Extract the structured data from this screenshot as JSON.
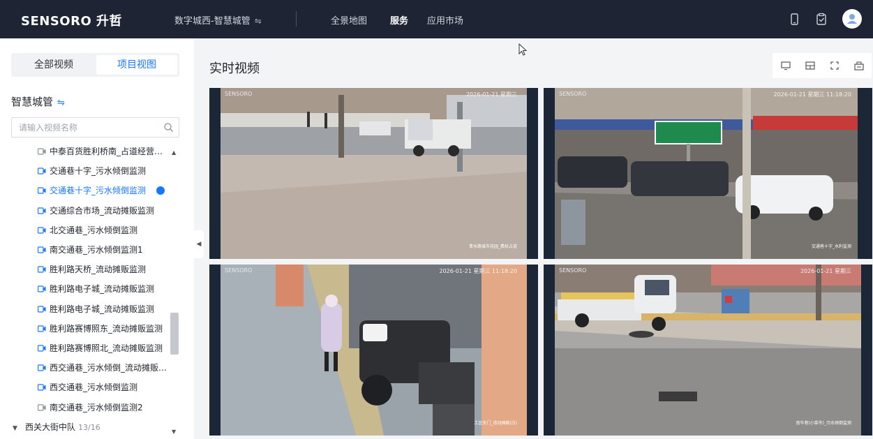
{
  "topbar": {
    "logo": "SENSORO 升哲",
    "project": "数字城西-智慧城管",
    "nav": [
      "全景地图",
      "服务",
      "应用市场"
    ],
    "nav_active": "服务"
  },
  "sidebar": {
    "tabs": [
      "全部视频",
      "项目视图"
    ],
    "active_tab": "项目视图",
    "group_title": "智慧城管",
    "search_placeholder": "请输入视频名称",
    "items": [
      {
        "label": "中泰百货胜利桥南_占道经营监测",
        "state": "offline"
      },
      {
        "label": "交通巷十字_污水倾倒监测",
        "state": "online"
      },
      {
        "label": "交通巷十字_污水倾倒监测",
        "state": "playing"
      },
      {
        "label": "交通综合市场_流动摊贩监测",
        "state": "online"
      },
      {
        "label": "北交通巷_污水倾倒监测",
        "state": "online"
      },
      {
        "label": "南交通巷_污水倾倒监测1",
        "state": "online"
      },
      {
        "label": "胜利路天桥_流动摊贩监测",
        "state": "online"
      },
      {
        "label": "胜利路电子城_流动摊贩监测",
        "state": "online"
      },
      {
        "label": "胜利路电子城_流动摊贩监测",
        "state": "online"
      },
      {
        "label": "胜利路赛博照东_流动摊贩监测",
        "state": "online"
      },
      {
        "label": "胜利路赛博照北_流动摊贩监测",
        "state": "online"
      },
      {
        "label": "西交通巷_污水倾倒_流动摊贩监测",
        "state": "online"
      },
      {
        "label": "西交通巷_污水倾倒监测",
        "state": "online"
      },
      {
        "label": "南交通巷_污水倾倒监测2",
        "state": "offline"
      }
    ],
    "group": {
      "label": "西关大街中队",
      "count": "13/16"
    }
  },
  "main": {
    "title": "实时视频",
    "toolbar_icons": [
      "monitor-icon",
      "layout-icon",
      "fullscreen-icon",
      "snapshot-icon"
    ],
    "videos": [
      {
        "brand": "SENSORO",
        "stamp": "2026-01-21 星期三",
        "label": "青水路城市花园_费机占道"
      },
      {
        "brand": "SENSORO",
        "stamp": "2026-01-21 星期三 11:18:20",
        "label": "交通巷十字_水利监测"
      },
      {
        "brand": "SENSORO",
        "stamp": "2026-01-21 星期三 11:18:20",
        "label": "工区东门_流动摊贩(白)"
      },
      {
        "brand": "SENSORO",
        "stamp": "2026-01-21 星期三",
        "label": "南华巷(小菜市)_污水倾倒监测"
      }
    ]
  },
  "colors": {
    "topbar": "#1e2433",
    "accent": "#1677ff",
    "background": "#f3f4f6"
  }
}
